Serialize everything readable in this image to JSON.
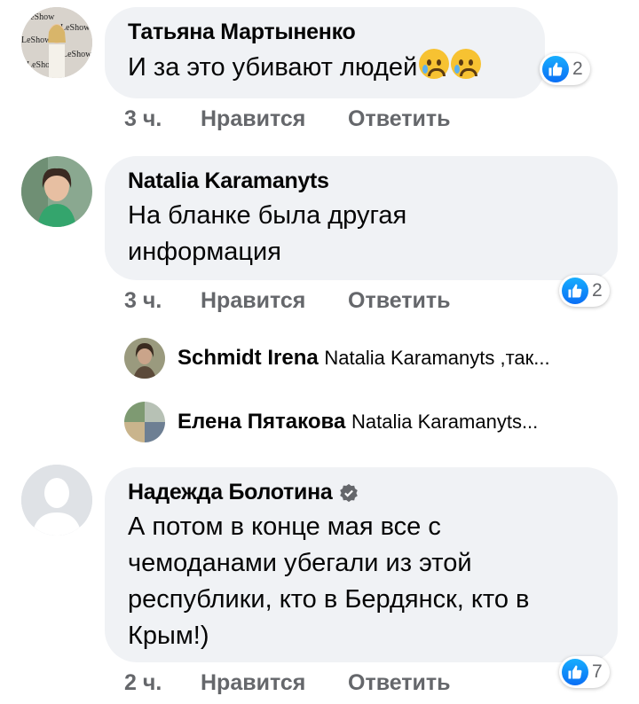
{
  "comments": [
    {
      "author": "Татьяна Мартыненко",
      "text": "И за это убивают людей",
      "emoji": [
        "crying-face",
        "crying-face"
      ],
      "time": "3 ч.",
      "like_label": "Нравится",
      "reply_label": "Ответить",
      "reaction_count": "2",
      "avatar_watermark": "LeShow"
    },
    {
      "author": "Natalia Karamanyts",
      "text_line1": "На бланке была другая",
      "text_line2": "информация",
      "time": "3 ч.",
      "like_label": "Нравится",
      "reply_label": "Ответить",
      "reaction_count": "2",
      "replies": [
        {
          "author": "Schmidt Irena",
          "snippet": "Natalia Karamanyts ,так..."
        },
        {
          "author": "Елена Пятакова",
          "snippet": "Natalia Karamanyts..."
        }
      ]
    },
    {
      "author": "Надежда Болотина",
      "verified": true,
      "text_line1": "А потом в конце мая все с",
      "text_line2": "чемоданами убегали из этой",
      "text_line3": "республики, кто в Бердянск, кто в",
      "text_line4": "Крым!)",
      "time": "2 ч.",
      "like_label": "Нравится",
      "reply_label": "Ответить",
      "reaction_count": "7"
    }
  ],
  "colors": {
    "bubble": "#f0f2f5",
    "meta": "#65676b",
    "like_blue": "#1877f2"
  }
}
